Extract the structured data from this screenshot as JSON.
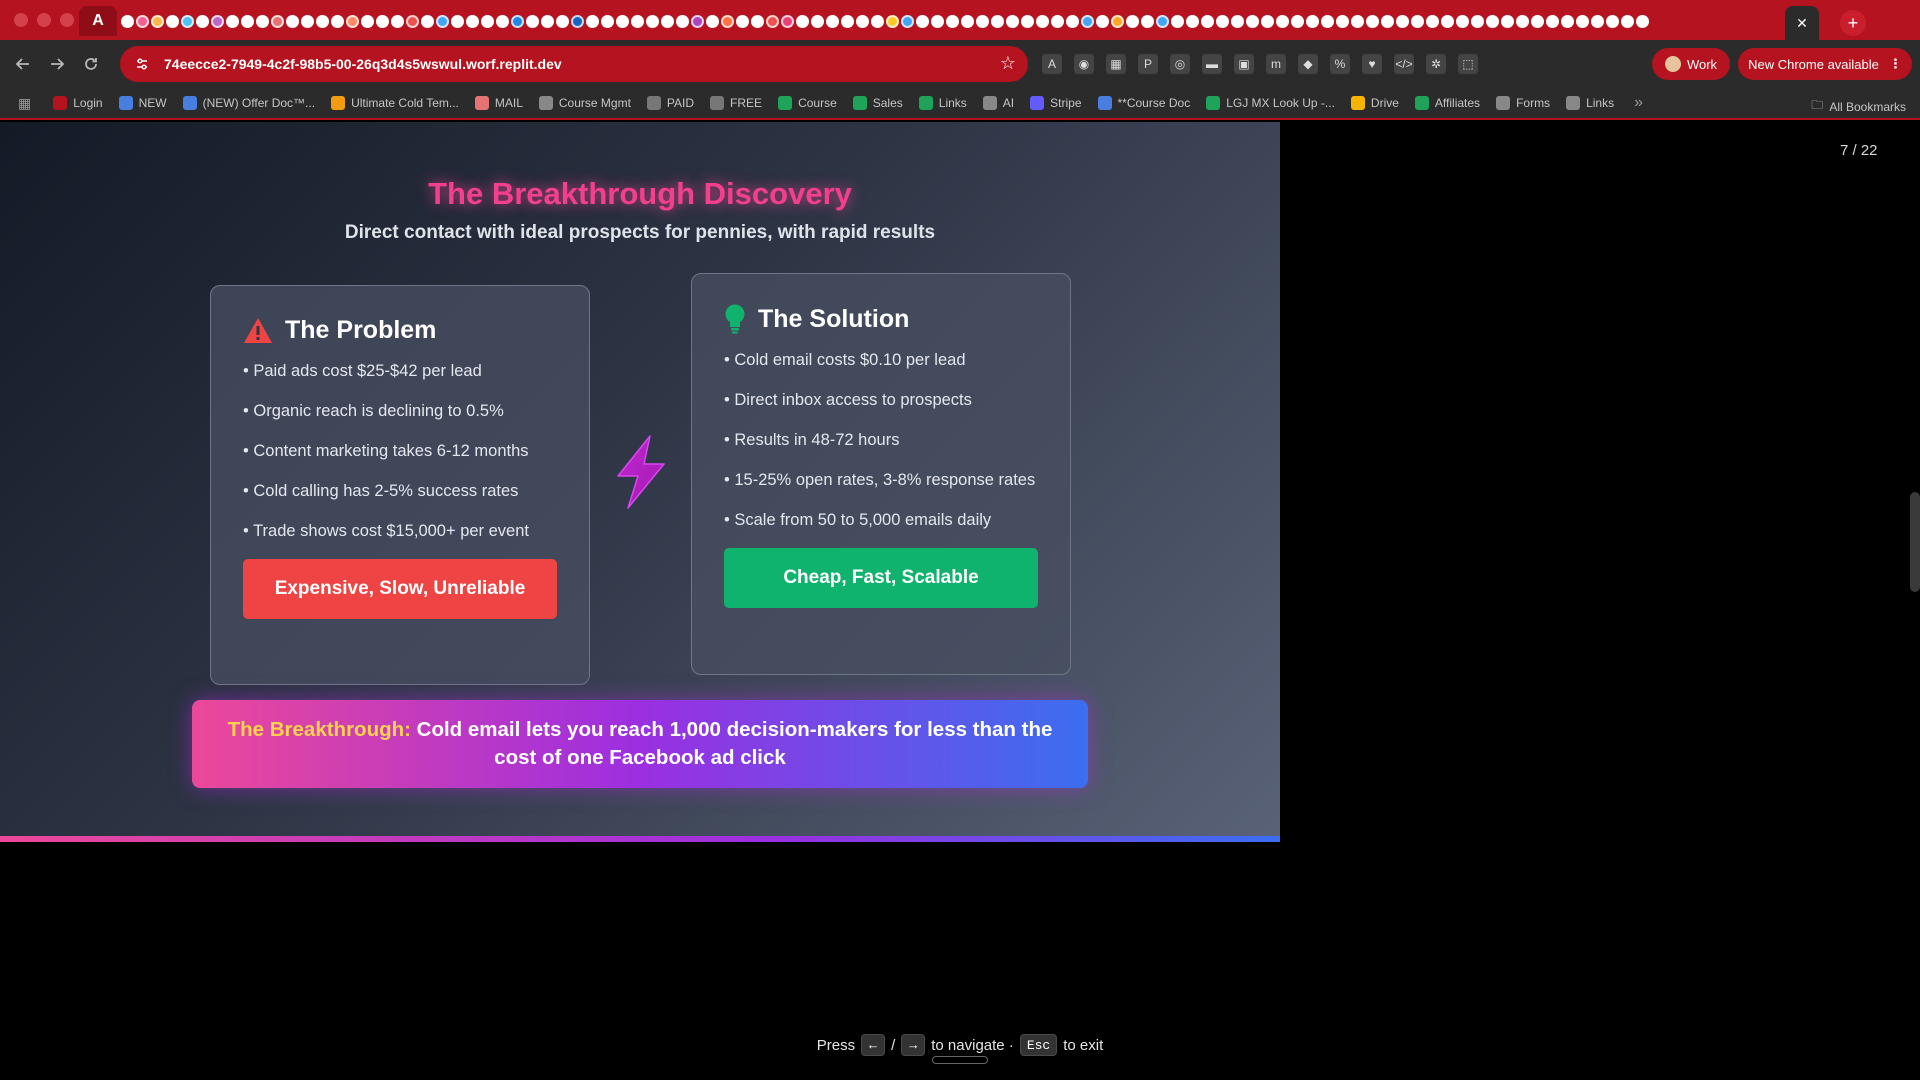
{
  "browser": {
    "url": "74eecce2-7949-4c2f-98b5-00-26q3d4s5wswul.worf.replit.dev",
    "profile_label": "Work",
    "update_label": "New Chrome available",
    "first_tab_glyph": "A",
    "active_tab_close": "✕",
    "new_tab_glyph": "+",
    "tab_favicon_colors": [
      "#ffffff",
      "#f06292",
      "#ffb74d",
      "#ffffff",
      "#4fc3f7",
      "#ffffff",
      "#ba68c8",
      "#ffffff",
      "#ffffff",
      "#ffffff",
      "#e57373",
      "#ffffff",
      "#ffffff",
      "#ffffff",
      "#ffffff",
      "#ff8a65",
      "#ffffff",
      "#ffffff",
      "#ffffff",
      "#ef5350",
      "#ffffff",
      "#42a5f5",
      "#ffffff",
      "#ffffff",
      "#ffffff",
      "#ffffff",
      "#1e88e5",
      "#ffffff",
      "#ffffff",
      "#ffffff",
      "#1565c0",
      "#ffffff",
      "#ffffff",
      "#ffffff",
      "#ffffff",
      "#ffffff",
      "#ffffff",
      "#ffffff",
      "#ab47bc",
      "#ffffff",
      "#ff7043",
      "#ffffff",
      "#ffffff",
      "#ef5350",
      "#ec407a",
      "#ffffff",
      "#ffffff",
      "#ffffff",
      "#ffffff",
      "#ffffff",
      "#ffffff",
      "#ffca28",
      "#42a5f5",
      "#ffffff",
      "#ffffff",
      "#ffffff",
      "#ffffff",
      "#ffffff",
      "#ffffff",
      "#ffffff",
      "#ffffff",
      "#ffffff",
      "#ffffff",
      "#ffffff",
      "#42a5f5",
      "#ffffff",
      "#ffa726",
      "#ffffff",
      "#ffffff",
      "#42a5f5",
      "#ffffff",
      "#ffffff",
      "#ffffff",
      "#ffffff",
      "#ffffff",
      "#ffffff",
      "#ffffff",
      "#ffffff",
      "#ffffff",
      "#ffffff",
      "#ffffff",
      "#ffffff",
      "#ffffff",
      "#ffffff",
      "#ffffff",
      "#ffffff",
      "#ffffff",
      "#ffffff",
      "#ffffff",
      "#ffffff",
      "#ffffff",
      "#ffffff",
      "#ffffff",
      "#ffffff",
      "#ffffff",
      "#ffffff",
      "#ffffff",
      "#ffffff",
      "#ffffff",
      "#ffffff",
      "#ffffff",
      "#ffffff"
    ],
    "extension_glyphs": [
      "A",
      "◉",
      "▦",
      "P",
      "◎",
      "▬",
      "▣",
      "m",
      "◆",
      "%",
      "♥",
      "</>",
      "✲",
      "⬚"
    ],
    "bookmarks": [
      {
        "label": "Login",
        "color": "#b5131f"
      },
      {
        "label": "NEW",
        "color": "#4a7de0"
      },
      {
        "label": "(NEW) Offer Doc™...",
        "color": "#4a7de0"
      },
      {
        "label": "Ultimate Cold Tem...",
        "color": "#f39c12"
      },
      {
        "label": "MAIL",
        "color": "#e57373"
      },
      {
        "label": "Course Mgmt",
        "color": "#888888"
      },
      {
        "label": "PAID",
        "color": "#777777"
      },
      {
        "label": "FREE",
        "color": "#777777"
      },
      {
        "label": "Course",
        "color": "#1fa35a"
      },
      {
        "label": "Sales",
        "color": "#1fa35a"
      },
      {
        "label": "Links",
        "color": "#1fa35a"
      },
      {
        "label": "AI",
        "color": "#888888"
      },
      {
        "label": "Stripe",
        "color": "#635bff"
      },
      {
        "label": "**Course Doc",
        "color": "#4a7de0"
      },
      {
        "label": "LGJ MX Look Up -...",
        "color": "#1fa35a"
      },
      {
        "label": "Drive",
        "color": "#f4b400"
      },
      {
        "label": "Affiliates",
        "color": "#1fa35a"
      },
      {
        "label": "Forms",
        "color": "#888888"
      },
      {
        "label": "Links",
        "color": "#888888"
      }
    ],
    "bookmarks_overflow": "»",
    "all_bookmarks_label": "All Bookmarks"
  },
  "slide": {
    "title": "The Breakthrough Discovery",
    "subtitle": "Direct contact with ideal prospects for pennies, with rapid results",
    "problem": {
      "title": "The Problem",
      "items": [
        "• Paid ads cost $25-$42 per lead",
        "• Organic reach is declining to 0.5%",
        "• Content marketing takes 6-12 months",
        "• Cold calling has 2-5% success rates",
        "• Trade shows cost $15,000+ per event"
      ],
      "button": "Expensive, Slow, Unreliable"
    },
    "solution": {
      "title": "The Solution",
      "items": [
        "• Cold email costs $0.10 per lead",
        "• Direct inbox access to prospects",
        "• Results in 48-72 hours",
        "• 15-25% open rates, 3-8% response rates",
        "• Scale from 50 to 5,000 emails daily"
      ],
      "button": "Cheap, Fast, Scalable"
    },
    "banner": {
      "highlight": "The Breakthrough:",
      "text": " Cold email lets you reach 1,000 decision-makers for less than the cost of one Facebook ad click"
    },
    "progress_fraction": 1.0
  },
  "presentation": {
    "counter": "7 / 22",
    "hint_press": "Press",
    "key_left": "←",
    "slash": "/",
    "key_right": "→",
    "hint_navigate": "to navigate ·",
    "key_esc": "Esc",
    "hint_exit": "to exit"
  },
  "colors": {
    "chrome_accent": "#b5131f",
    "title_pink": "#f43f8c",
    "problem_red": "#ef4444",
    "solution_green": "#10b36e",
    "highlight_yellow": "#fcd34d"
  }
}
